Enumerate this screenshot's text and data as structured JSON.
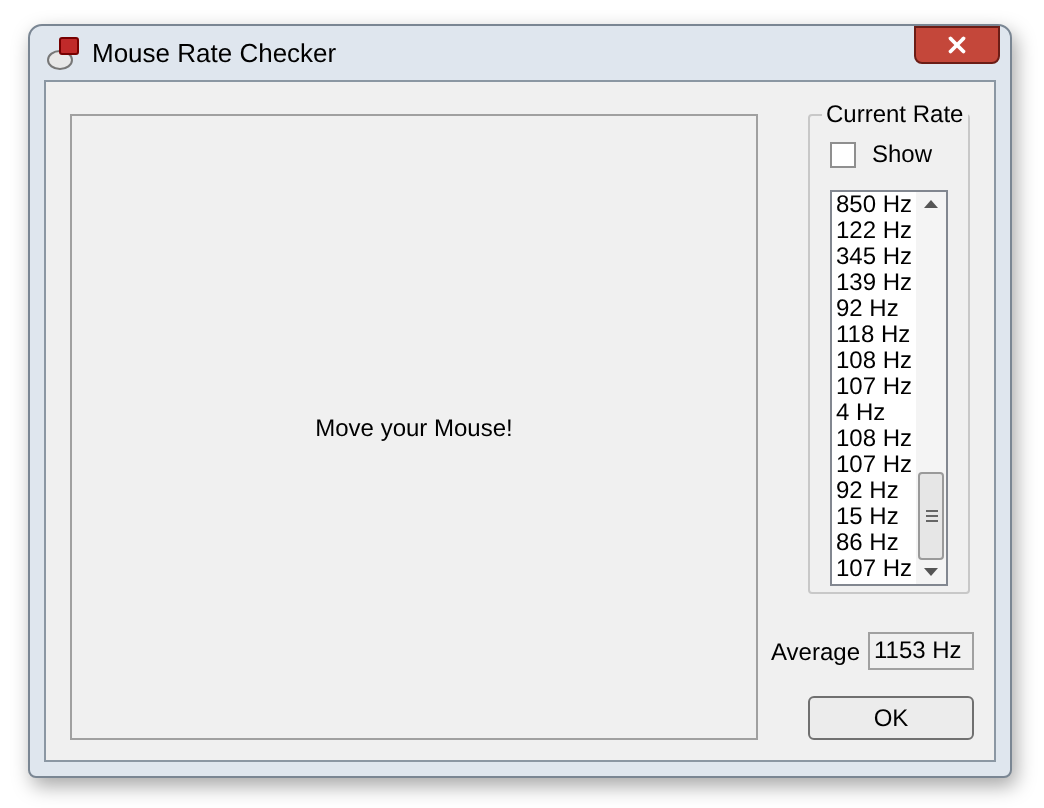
{
  "window": {
    "title": "Mouse Rate Checker"
  },
  "canvas": {
    "message": "Move your Mouse!"
  },
  "current_rate": {
    "title": "Current Rate",
    "show": {
      "label": "Show",
      "checked": false
    },
    "list": [
      "850 Hz",
      "122 Hz",
      "345 Hz",
      "139 Hz",
      "92 Hz",
      "118 Hz",
      "108 Hz",
      "107 Hz",
      "4 Hz",
      "108 Hz",
      "107 Hz",
      "92 Hz",
      "15 Hz",
      "86 Hz",
      "107 Hz"
    ]
  },
  "average": {
    "label": "Average",
    "value": "1153 Hz"
  },
  "buttons": [
    "OK"
  ]
}
